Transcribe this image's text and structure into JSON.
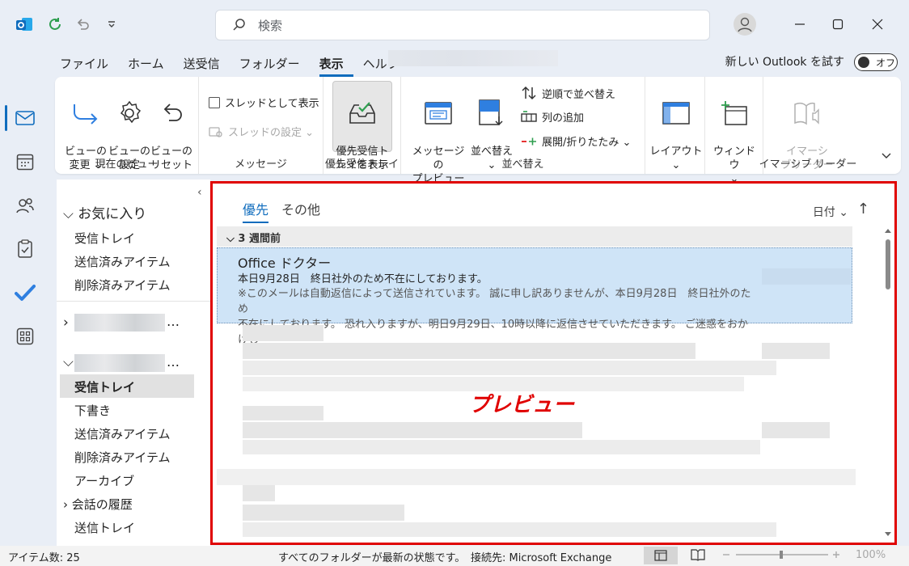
{
  "titlebar": {
    "search_placeholder": "検索"
  },
  "menu": {
    "tabs": [
      "ファイル",
      "ホーム",
      "送受信",
      "フォルダー",
      "表示",
      "ヘルプ"
    ],
    "active_index": 4,
    "new_outlook_label": "新しい Outlook を試す",
    "toggle_label": "オフ"
  },
  "ribbon": {
    "current_view": {
      "group_label": "現在のビュー",
      "change_view": "ビューの\n変更 ⌄",
      "view_settings": "ビューの\n設定",
      "reset_view": "ビューの\nリセット"
    },
    "messages": {
      "group_label": "メッセージ",
      "show_as_thread": "スレッドとして表示",
      "thread_settings": "スレッドの設定 ⌄"
    },
    "focused": {
      "group_label": "優先受信トレイ",
      "show_focused": "優先受信ト\nレイを表示"
    },
    "arrangement": {
      "group_label": "並べ替え",
      "message_preview": "メッセージの\nプレビュー ⌄",
      "sort": "並べ替え\n⌄",
      "reverse_sort": "逆順で並べ替え",
      "add_column": "列の追加",
      "expand_collapse": "展開/折りたたみ ⌄"
    },
    "layout": {
      "layout": "レイアウト\n⌄",
      "window": "ウィンドウ\n⌄"
    },
    "immersive": {
      "group_label": "イマーシブ リーダー",
      "immersive_reader": "イマーシ\nブリーダー"
    }
  },
  "folders": {
    "favorites_header": "お気に入り",
    "favorites": [
      "受信トレイ",
      "送信済みアイテム",
      "削除済みアイテム"
    ],
    "account_ellipsis": "…",
    "account_items": [
      "受信トレイ",
      "下書き",
      "送信済みアイテム",
      "削除済みアイテム",
      "アーカイブ",
      "会話の履歴",
      "送信トレイ"
    ],
    "selected_index": 0
  },
  "maillist": {
    "tabs": [
      "優先",
      "その他"
    ],
    "active_tab": 0,
    "sort_label": "日付 ⌄",
    "sort_dir": "↑",
    "group_header": "3 週間前",
    "selected_mail": {
      "from": "Office ドクター",
      "subject": "本日9月28日　終日社外のため不在にしております。",
      "preview_line1": "※このメールは自動返信によって送信されています。 誠に申し訳ありませんが、本日9月28日　終日社外のため",
      "preview_line2": "不在にしております。 恐れ入りますが、明日9月29日、10時以降に返信させていただきます。 ご迷惑をおかけし"
    },
    "annotation": "プレビュー"
  },
  "statusbar": {
    "items_count": "アイテム数: 25",
    "sync_status": "すべてのフォルダーが最新の状態です。",
    "connection": "接続先: Microsoft Exchange",
    "zoom": "100%"
  },
  "colors": {
    "accent": "#0f6cbd",
    "annotation_red": "#e00000",
    "selection": "#cfe4f7"
  }
}
